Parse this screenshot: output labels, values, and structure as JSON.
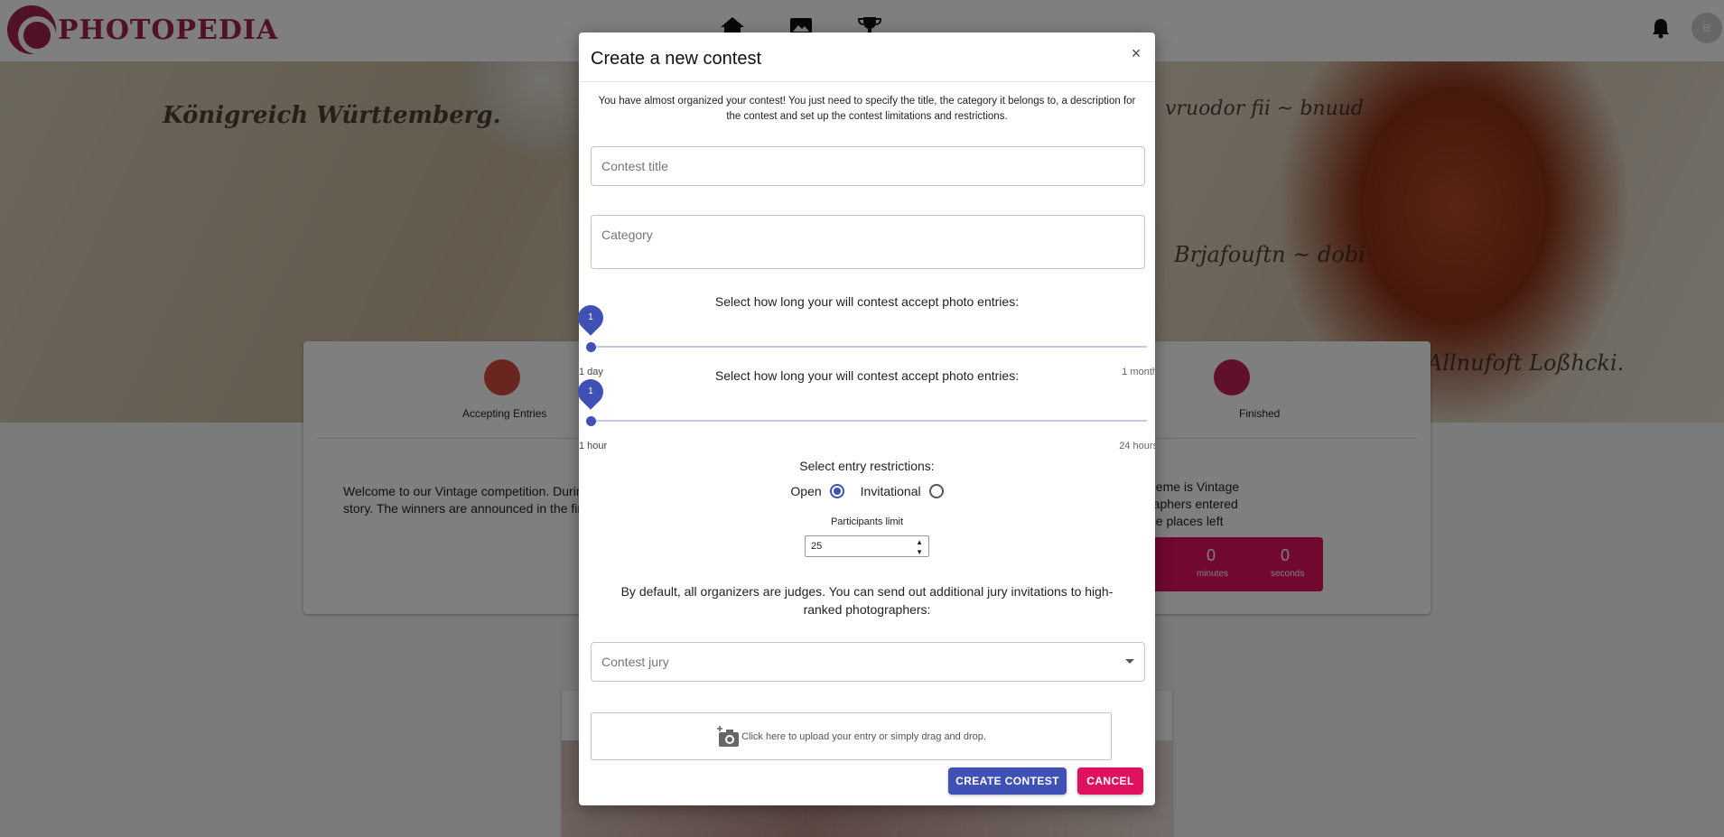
{
  "app": {
    "brand": "PHOTOPEDIA",
    "avatar_initial": "e"
  },
  "background_page": {
    "steps": [
      "Accepting Entries",
      "Finished"
    ],
    "welcome_text_line1": "Welcome to our Vintage competition. During",
    "welcome_text_line2": "story. The winners are announced in the final",
    "info_line1": "heme is Vintage",
    "info_line2": "raphers entered",
    "info_line3": "ee places left",
    "countdown": [
      {
        "value": "0",
        "label": "minutes"
      },
      {
        "value": "0",
        "label": "seconds"
      }
    ]
  },
  "modal": {
    "title": "Create a new contest",
    "close_label": "×",
    "intro": "You have almost organized your contest! You just need to specify the title, the category it belongs to, a description for the contest and set up the contest limitations and restrictions.",
    "title_placeholder": "Contest title",
    "category_placeholder": "Category",
    "entries_slider": {
      "label": "Select how long your will contest accept photo entries:",
      "value": "1",
      "min_label": "1 day",
      "max_label": "1 month",
      "fraction": 0
    },
    "hours_slider": {
      "label": "Select how long your will contest accept photo entries:",
      "value": "1",
      "min_label": "1 hour",
      "max_label": "24 hours",
      "fraction": 0
    },
    "restrictions": {
      "label": "Select entry restrictions:",
      "options": [
        "Open",
        "Invitational"
      ],
      "selected": "Open"
    },
    "participants": {
      "label": "Participants limit",
      "value": "25"
    },
    "jury_text": "By default, all organizers are judges. You can send out additional jury invitations to high-ranked photographers:",
    "jury_placeholder": "Contest jury",
    "upload_text": "Click here to upload your entry or simply drag and drop.",
    "create_label": "CREATE CONTEST",
    "cancel_label": "CANCEL"
  },
  "colors": {
    "primary": "#3f51b5",
    "accent": "#e0115f",
    "brand": "#a3224f"
  }
}
